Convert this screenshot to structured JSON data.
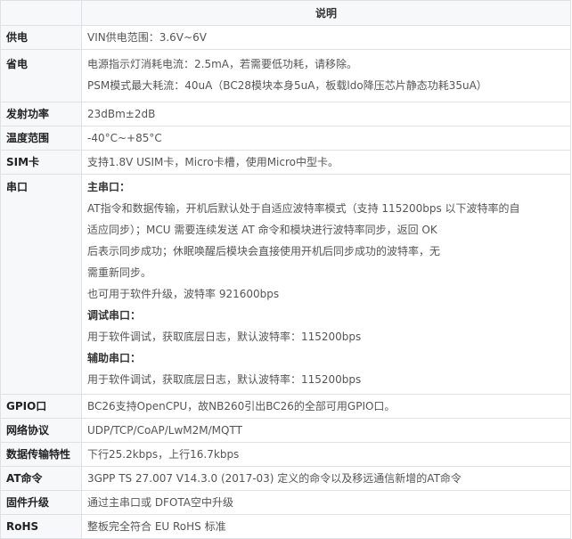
{
  "header": {
    "col1": "",
    "col2": "说明"
  },
  "rows": [
    {
      "key": "供电",
      "lines": [
        "VIN供电范围：3.6V~6V"
      ]
    },
    {
      "key": "省电",
      "lines": [
        "电源指示灯消耗电流：2.5mA，若需要低功耗，请移除。",
        "PSM模式最大耗流：40uA（BC28模块本身5uA，板载ldo降压芯片静态功耗35uA）"
      ]
    },
    {
      "key": "发射功率",
      "lines": [
        "23dBm±2dB"
      ]
    },
    {
      "key": "温度范围",
      "lines": [
        "-40°C~+85°C"
      ]
    },
    {
      "key": "SIM卡",
      "lines": [
        "支持1.8V USIM卡，Micro卡槽，使用Micro中型卡。"
      ]
    },
    {
      "key": "串口",
      "lines": [
        {
          "t": "主串口：",
          "b": true
        },
        {
          "t": "AT指令和数据传输，开机后默认处于自适应波特率模式（支持 115200bps 以下波特率的自"
        },
        {
          "t": "适应同步）；MCU 需要连续发送 AT 命令和模块进行波特率同步，返回 OK"
        },
        {
          "t": "后表示同步成功；休眠唤醒后模块会直接使用开机后同步成功的波特率，无"
        },
        {
          "t": "需重新同步。"
        },
        {
          "t": "也可用于软件升级，波特率 921600bps"
        },
        {
          "t": "调试串口：",
          "b": true
        },
        {
          "t": "用于软件调试，获取底层日志，默认波特率：115200bps"
        },
        {
          "t": "辅助串口：",
          "b": true
        },
        {
          "t": "用于软件调试，获取底层日志，默认波特率：115200bps"
        }
      ]
    },
    {
      "key": "GPIO口",
      "lines": [
        "BC26支持OpenCPU，故NB260引出BC26的全部可用GPIO口。"
      ]
    },
    {
      "key": "网络协议",
      "lines": [
        "UDP/TCP/CoAP/LwM2M/MQTT"
      ]
    },
    {
      "key": "数据传输特性",
      "lines": [
        "下行25.2kbps，上行16.7kbps"
      ]
    },
    {
      "key": "AT命令",
      "lines": [
        "3GPP TS 27.007 V14.3.0 (2017-03) 定义的命令以及移远通信新增的AT命令"
      ]
    },
    {
      "key": "固件升级",
      "lines": [
        "通过主串口或 DFOTA空中升级"
      ]
    },
    {
      "key": "RoHS",
      "lines": [
        "整板完全符合 EU RoHS 标准"
      ]
    }
  ]
}
